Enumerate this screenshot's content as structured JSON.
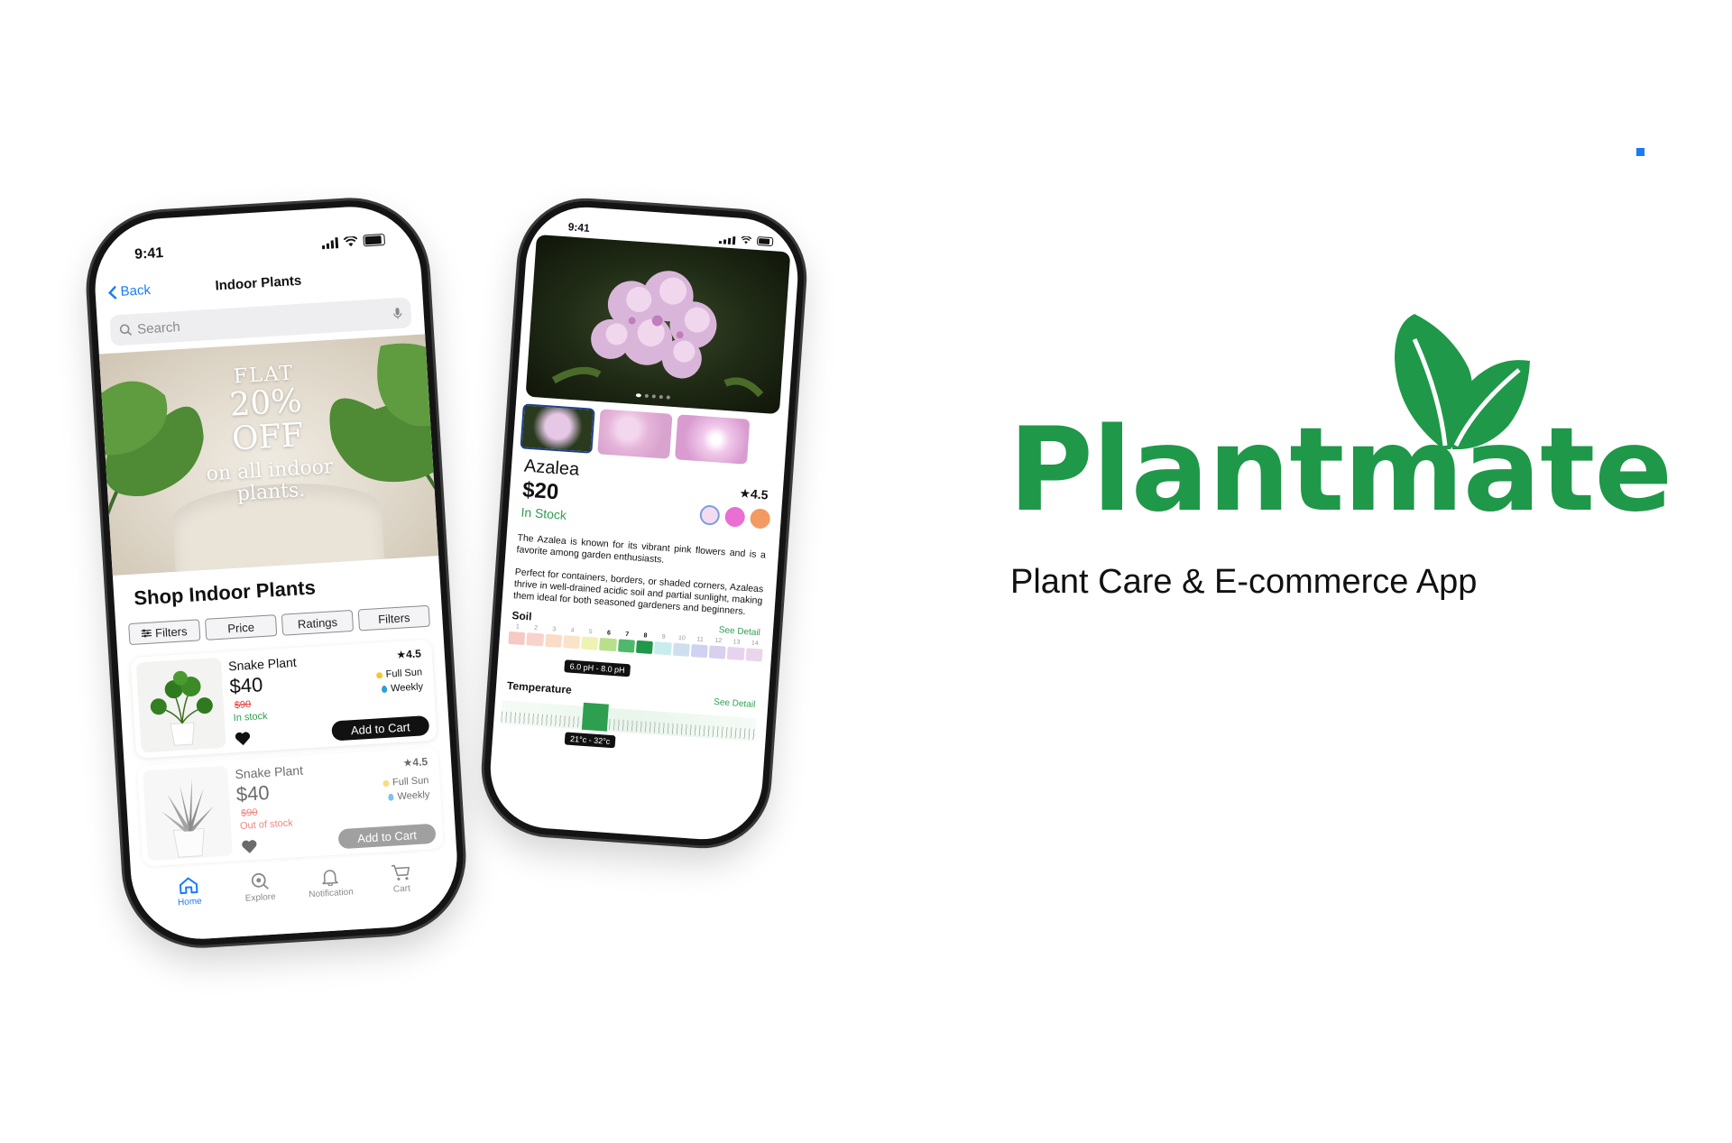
{
  "brand": {
    "name": "Plantmate",
    "tagline": "Plant Care & E-commerce App",
    "color": "#1f9849"
  },
  "phone1": {
    "status_time": "9:41",
    "nav": {
      "back_label": "Back",
      "title": "Indoor Plants"
    },
    "search": {
      "placeholder": "Search",
      "icon": "search-icon",
      "mic_icon": "microphone-icon"
    },
    "banner": {
      "line1": "FLAT",
      "line2": "20%",
      "line3": "OFF",
      "line4": "on all indoor",
      "line5": "plants."
    },
    "section_title": "Shop Indoor Plants",
    "chips": [
      "Filters",
      "Price",
      "Ratings",
      "Filters"
    ],
    "products": [
      {
        "name": "Snake Plant",
        "price": "$40",
        "old_price": "$90",
        "stock": "In stock",
        "stock_color": "#2e9e4f",
        "rating": "4.5",
        "sun": "Full Sun",
        "water": "Weekly",
        "button": "Add to Cart"
      },
      {
        "name": "Snake Plant",
        "price": "$40",
        "old_price": "$90",
        "stock": "Out of stock",
        "stock_color": "#e53935",
        "rating": "4.5",
        "sun": "Full Sun",
        "water": "Weekly",
        "button": "Add to Cart"
      }
    ],
    "tabs": [
      {
        "label": "Home",
        "icon": "home-icon",
        "active": true
      },
      {
        "label": "Explore",
        "icon": "explore-icon",
        "active": false
      },
      {
        "label": "Notification",
        "icon": "bell-icon",
        "active": false
      },
      {
        "label": "Cart",
        "icon": "cart-icon",
        "active": false
      }
    ]
  },
  "phone2": {
    "status_time": "9:41",
    "product": {
      "name": "Azalea",
      "price": "$20",
      "rating": "4.5",
      "stock": "In Stock",
      "colors": [
        "#f3dcf0",
        "#e96fd3",
        "#f39a63"
      ],
      "desc1": "The Azalea is known for its vibrant pink flowers and is a favorite among garden enthusiasts.",
      "desc2": "Perfect for containers, borders, or shaded corners, Azaleas thrive in well-drained acidic soil and partial sunlight, making them ideal for both seasoned gardeners and beginners."
    },
    "soil": {
      "label": "Soil",
      "see_detail": "See Detail",
      "scale": [
        "1",
        "2",
        "3",
        "4",
        "5",
        "6",
        "7",
        "8",
        "9",
        "10",
        "11",
        "12",
        "13",
        "14"
      ],
      "highlight": [
        "6",
        "7",
        "8"
      ],
      "range": "6.0 pH - 8.0 pH",
      "colors": [
        "#f6c9c4",
        "#f8d3cc",
        "#fbdcc8",
        "#fbe3c9",
        "#eef2b2",
        "#b8e08a",
        "#4fb86a",
        "#1f9849",
        "#c9ecec",
        "#d0dff0",
        "#cfd2f0",
        "#d8d0ef",
        "#e8d3ef",
        "#ead5ec"
      ]
    },
    "temperature": {
      "label": "Temperature",
      "see_detail": "See Detail",
      "range": "21°c - 32°c"
    }
  }
}
